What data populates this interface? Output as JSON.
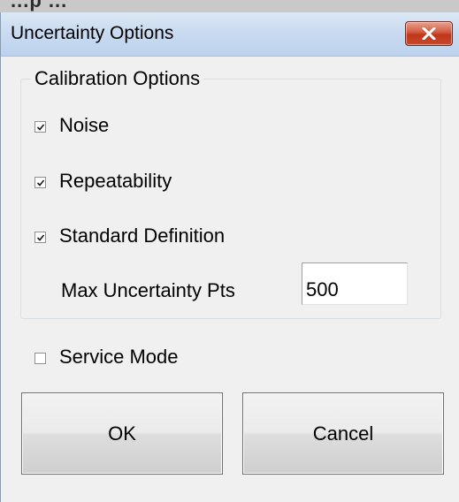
{
  "background_strip": {
    "text": "...p ..."
  },
  "dialog": {
    "title": "Uncertainty Options",
    "close_icon": "close-x-icon"
  },
  "calibration_group": {
    "legend": "Calibration Options",
    "options": [
      {
        "label": "Noise",
        "checked": true
      },
      {
        "label": "Repeatability",
        "checked": true
      },
      {
        "label": "Standard Definition",
        "checked": true
      }
    ],
    "max_points": {
      "label": "Max Uncertainty Pts",
      "value": "500"
    }
  },
  "service_mode": {
    "label": "Service Mode",
    "checked": false
  },
  "buttons": {
    "ok_label": "OK",
    "cancel_label": "Cancel"
  },
  "colors": {
    "dialog_background": "#f0f0f0",
    "title_bar": "#c8daf0",
    "close_button": "#c7482c"
  }
}
